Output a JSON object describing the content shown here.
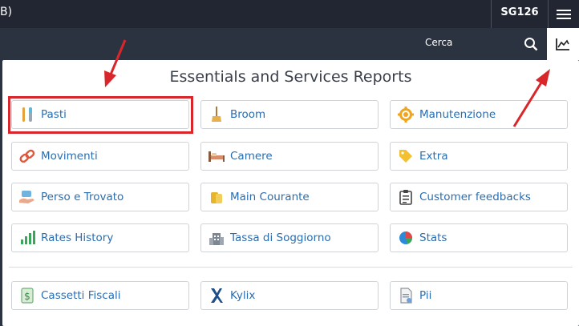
{
  "topbar": {
    "brand": "B)",
    "hotel_code": "SG126"
  },
  "search": {
    "label": "Cerca"
  },
  "panel": {
    "title": "Essentials and Services Reports"
  },
  "items": [
    {
      "label": "Pasti",
      "icon": "cutlery-icon"
    },
    {
      "label": "Broom",
      "icon": "broom-icon"
    },
    {
      "label": "Manutenzione",
      "icon": "gear-icon"
    },
    {
      "label": "Movimenti",
      "icon": "link-icon"
    },
    {
      "label": "Camere",
      "icon": "bed-icon"
    },
    {
      "label": "Extra",
      "icon": "tag-icon"
    },
    {
      "label": "Perso e Trovato",
      "icon": "hand-icon"
    },
    {
      "label": "Main Courante",
      "icon": "coins-icon"
    },
    {
      "label": "Customer feedbacks",
      "icon": "clipboard-icon"
    },
    {
      "label": "Rates History",
      "icon": "bar-chart-icon"
    },
    {
      "label": "Tassa di Soggiorno",
      "icon": "building-icon"
    },
    {
      "label": "Stats",
      "icon": "pie-chart-icon"
    },
    {
      "label": "Cassetti Fiscali",
      "icon": "cash-icon"
    },
    {
      "label": "Kylix",
      "icon": "kylix-icon"
    },
    {
      "label": "Pii",
      "icon": "document-icon"
    }
  ],
  "colors": {
    "accent": "#2a6db0",
    "annotation": "#d9262b",
    "topbar": "#212632",
    "navbar": "#2c3340"
  }
}
